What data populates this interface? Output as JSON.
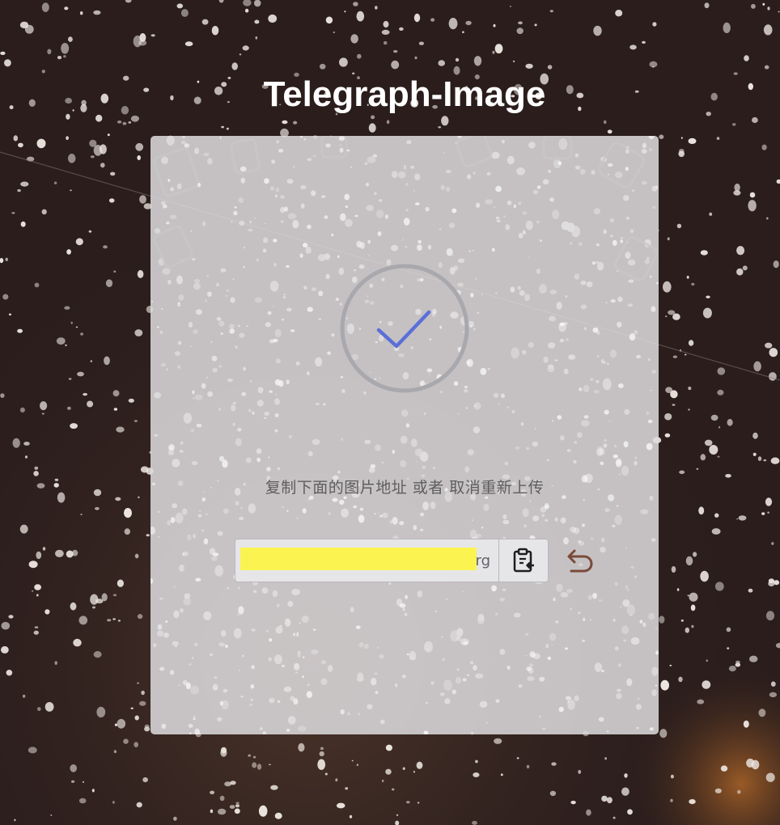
{
  "page": {
    "title": "Telegraph-Image"
  },
  "upload_result": {
    "status": "success",
    "status_icon": "check-circle-icon",
    "message": "复制下面的图片地址 或者 取消重新上传",
    "url_value": "https://telegra.ph/file/xxxxxxxx.org",
    "url_redacted": true,
    "copy_icon": "clipboard-icon",
    "reset_icon": "undo-icon"
  },
  "colors": {
    "check": "#5b6fd8",
    "ring": "#a8a8ad",
    "reset_icon": "#7a4a3a",
    "redaction": "#fbf450"
  }
}
